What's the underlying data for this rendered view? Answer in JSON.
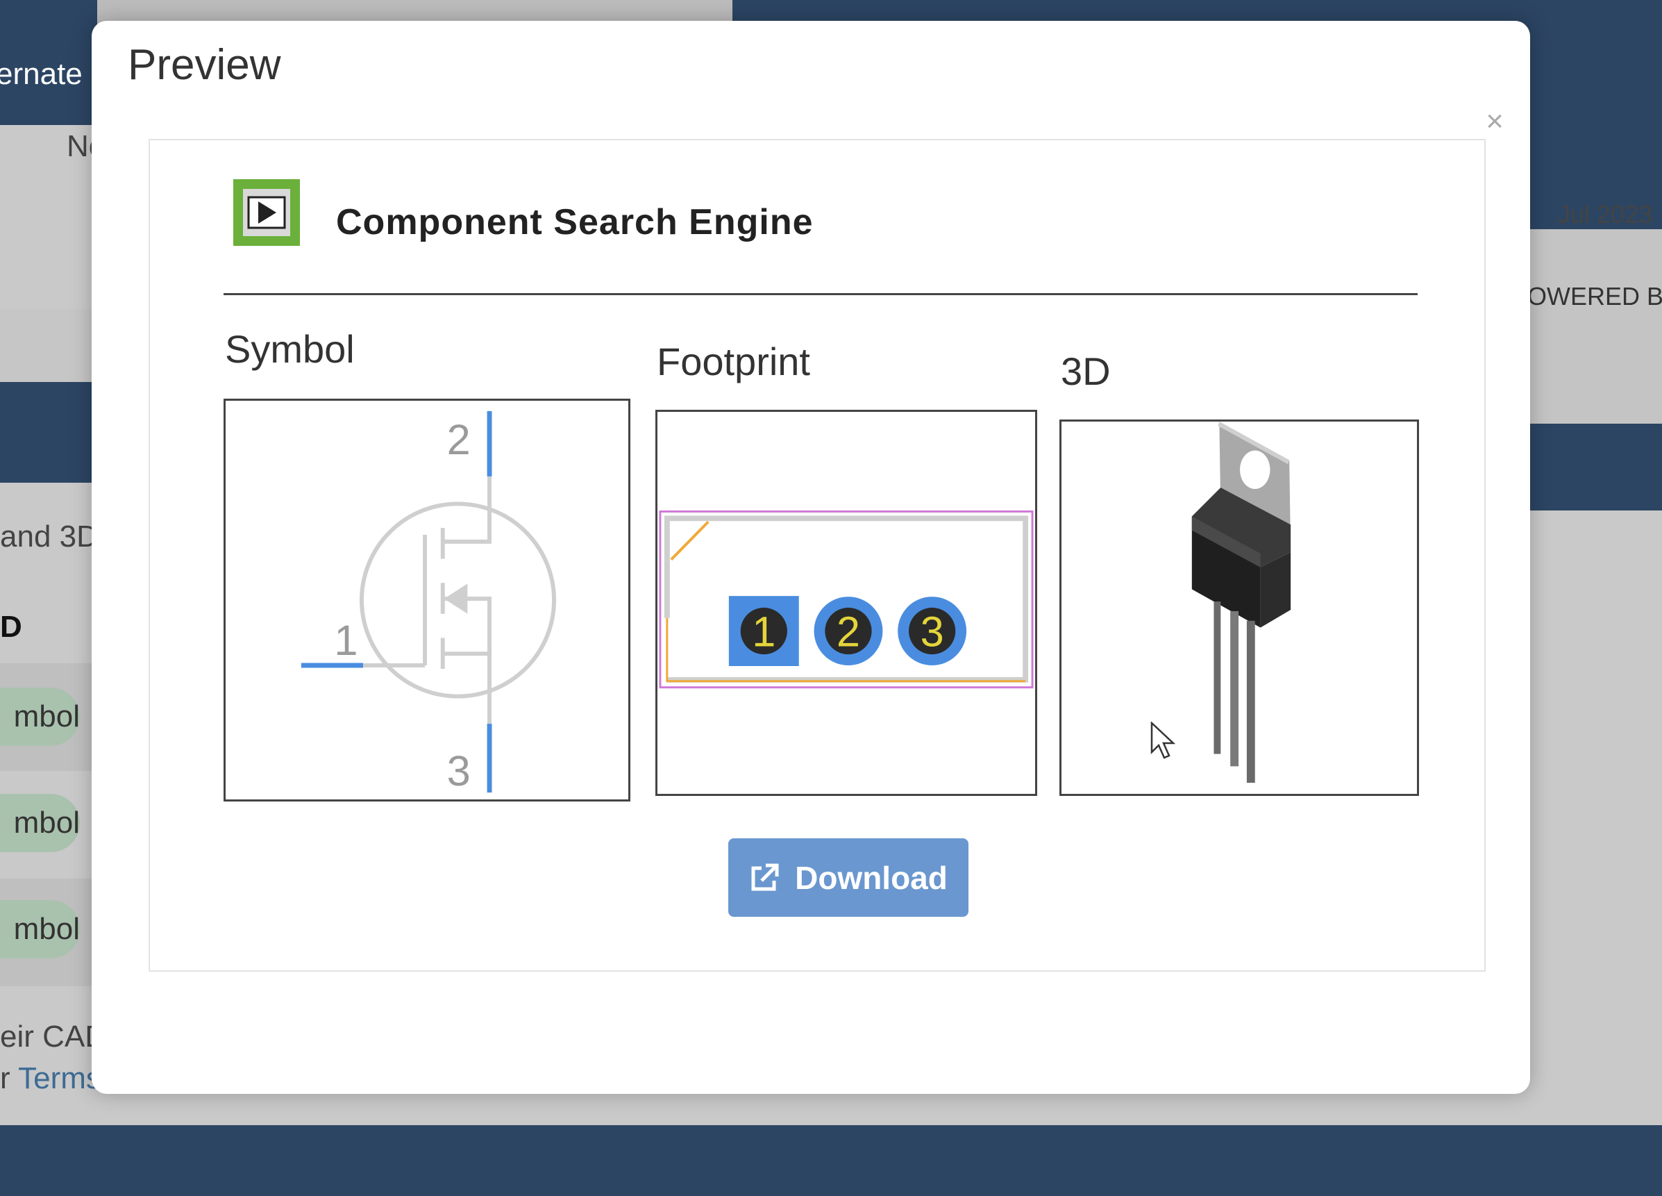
{
  "background": {
    "topbar_partial": "ernate",
    "col_partial": "No",
    "date_partial": "Jul 2023",
    "powered_partial": "OWERED BY",
    "and3d_partial": "and 3D",
    "col_head_partial": "D",
    "pills": [
      "mbol",
      "mbol",
      "mbol"
    ],
    "cad_partial": "eir CAD",
    "terms_prefix": "r",
    "terms_link": "Terms"
  },
  "modal": {
    "title": "Preview",
    "close_glyph": "×",
    "brand_name": "Component Search Engine",
    "sections": {
      "symbol": "Symbol",
      "footprint": "Footprint",
      "three_d": "3D"
    },
    "symbol_pins": {
      "gate": "1",
      "drain": "2",
      "source": "3"
    },
    "footprint_pads": [
      "1",
      "2",
      "3"
    ],
    "download_label": "Download",
    "colors": {
      "accent": "#6a97cf",
      "pin_blue": "#4a8de0",
      "pad_yellow": "#e4d53a",
      "outline_magenta": "#cf79d8",
      "outline_orange": "#f0a938",
      "brand_green": "#6ab03a"
    },
    "icons": [
      "component-search-engine-logo-icon",
      "close-icon",
      "external-link-icon",
      "mouse-cursor-icon"
    ]
  }
}
